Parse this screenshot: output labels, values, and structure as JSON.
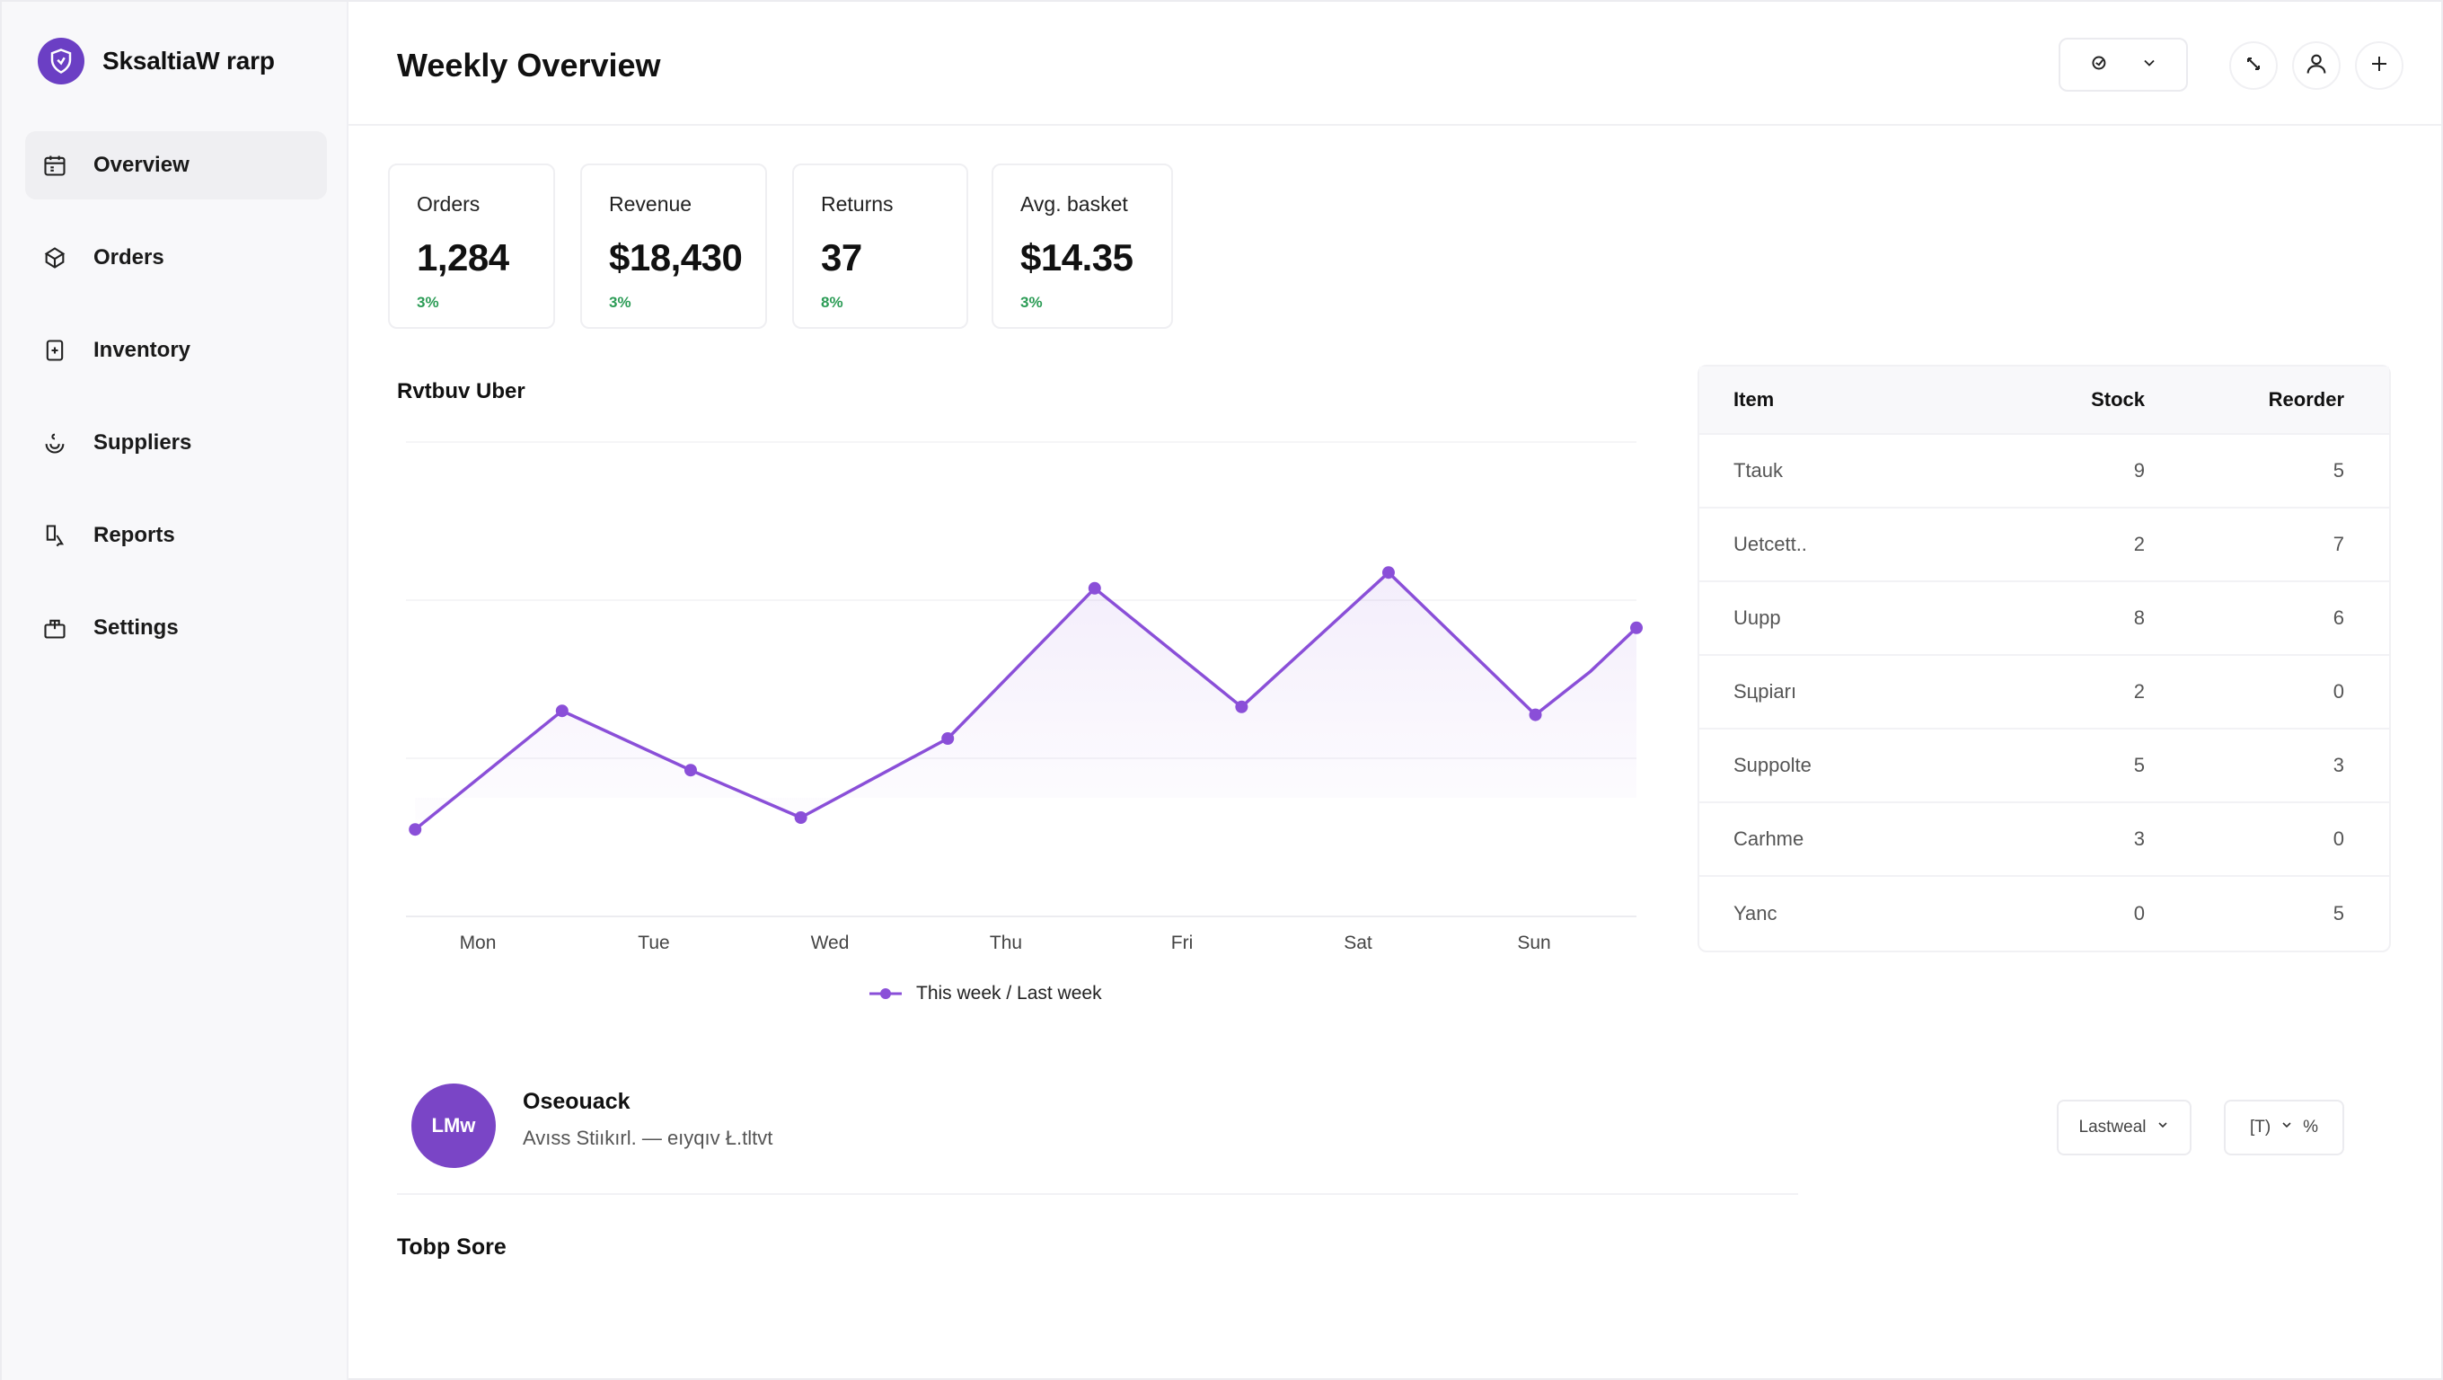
{
  "app": {
    "brand_name": "SksaltiaW rarp"
  },
  "sidebar": {
    "items": [
      {
        "label": "Overview",
        "icon": "calendar-icon",
        "active": true
      },
      {
        "label": "Orders",
        "icon": "box-icon",
        "active": false
      },
      {
        "label": "Inventory",
        "icon": "clipboard-icon",
        "active": false
      },
      {
        "label": "Suppliers",
        "icon": "handshake-icon",
        "active": false
      },
      {
        "label": "Reports",
        "icon": "document-pointer-icon",
        "active": false
      },
      {
        "label": "Settings",
        "icon": "shopping-bag-icon",
        "active": false
      }
    ]
  },
  "header": {
    "title": "Weekly Overview"
  },
  "kpis": [
    {
      "label": "Orders",
      "value": "1,284",
      "delta": "3%"
    },
    {
      "label": "Revenue",
      "value": "$18,430",
      "delta": "3%"
    },
    {
      "label": "Returns",
      "value": "37",
      "delta": "8%"
    },
    {
      "label": "Avg. basket",
      "value": "$14.35",
      "delta": "3%"
    }
  ],
  "chart": {
    "title": "Rvtbuv Uber",
    "legend_label": "This week / Last week"
  },
  "chart_data": {
    "type": "line",
    "categories": [
      "Mon",
      "Tue",
      "Wed",
      "Thu",
      "Fri",
      "Sat",
      "Sun"
    ],
    "series": [
      {
        "name": "This week / Last week",
        "x": [
          0,
          0.8,
          1.5,
          2.1,
          2.9,
          3.7,
          4.5,
          5.3,
          6.1,
          6.4,
          6.65
        ],
        "values": [
          22,
          52,
          37,
          25,
          45,
          83,
          53,
          87,
          51,
          62,
          73
        ]
      }
    ],
    "xlim": [
      -0.05,
      6.65
    ],
    "ylim": [
      0,
      120
    ],
    "grid": true,
    "color": "#8a4fd8"
  },
  "table": {
    "headers": [
      "Item",
      "Stock",
      "Reorder"
    ],
    "rows": [
      [
        "Ttauk",
        "9",
        "5"
      ],
      [
        "Uetcett..",
        "2",
        "7"
      ],
      [
        "Uupp",
        "8",
        "6"
      ],
      [
        "Sцpiarı",
        "2",
        "0"
      ],
      [
        "Suppolte",
        "5",
        "3"
      ],
      [
        "Carhme",
        "3",
        "0"
      ],
      [
        "Yanc",
        "0",
        "5"
      ]
    ]
  },
  "profile": {
    "initials": "LMw",
    "name": "Oseouack",
    "subtitle": "Avıss Stiıkırl. — eıyqıv Ł.tltvt"
  },
  "controls": {
    "period_select": "Lastweal",
    "view_select": "[Т)",
    "view_suffix": "%"
  },
  "section": {
    "title": "Tobp Sore"
  },
  "colors": {
    "accent": "#7a45c6",
    "line": "#8a4fd8",
    "positive": "#2c9c56"
  }
}
